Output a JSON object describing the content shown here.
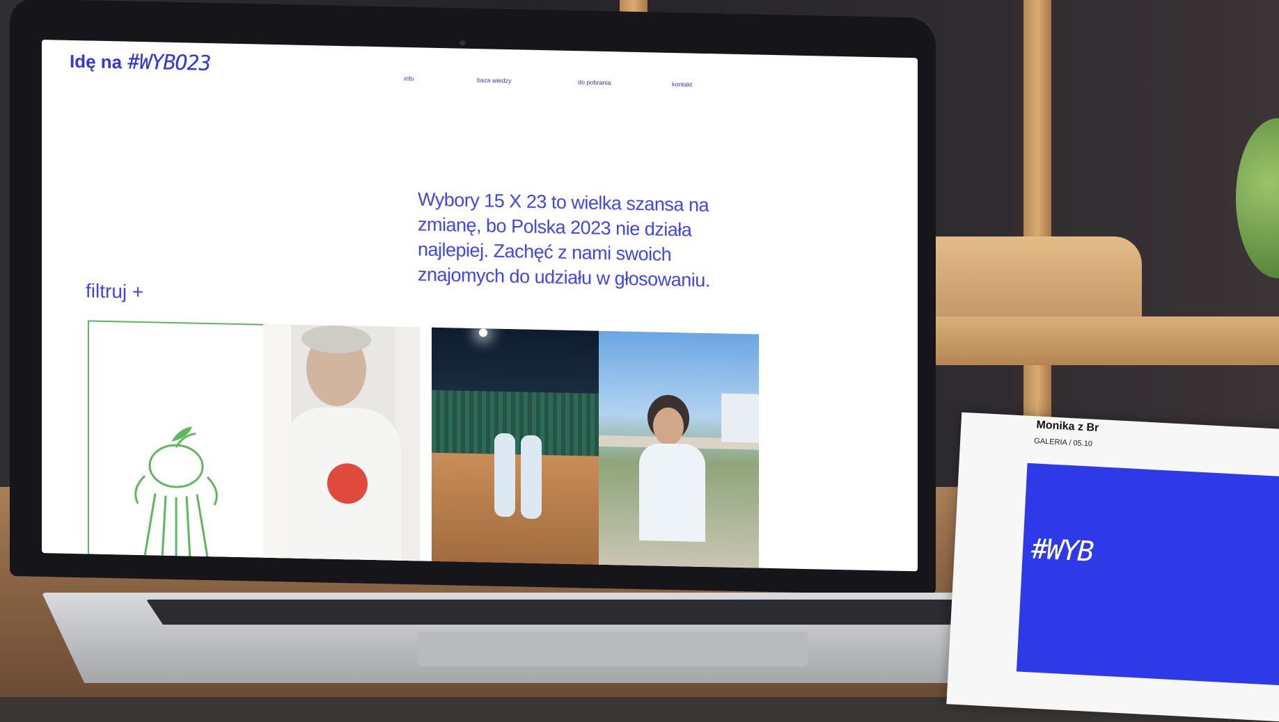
{
  "site": {
    "logo_text": "Idę na",
    "logo_tag": "#WYBO23",
    "nav": [
      "info",
      "baza wiedzy",
      "do pobrania",
      "kontakt"
    ],
    "hero_text": "Wybory 15 X 23 to wielka szansa na zmianę, bo Polska 2023 nie działa najlepiej. Zachęć z nami swoich znajomych do udziału w głosowaniu.",
    "filter_label": "filtruj +"
  },
  "gallery": {
    "tiles": [
      "illustration",
      "photo-man-shirt",
      "photo-tennis-court",
      "photo-lakeside"
    ]
  },
  "card": {
    "title": "Monika z Br",
    "meta": "GALERIA / 05.10",
    "tag": "#WYB"
  },
  "colors": {
    "brand_blue": "#3d44ff",
    "illustration_green": "#5cb85a",
    "shirt_red": "#e04a3a"
  }
}
